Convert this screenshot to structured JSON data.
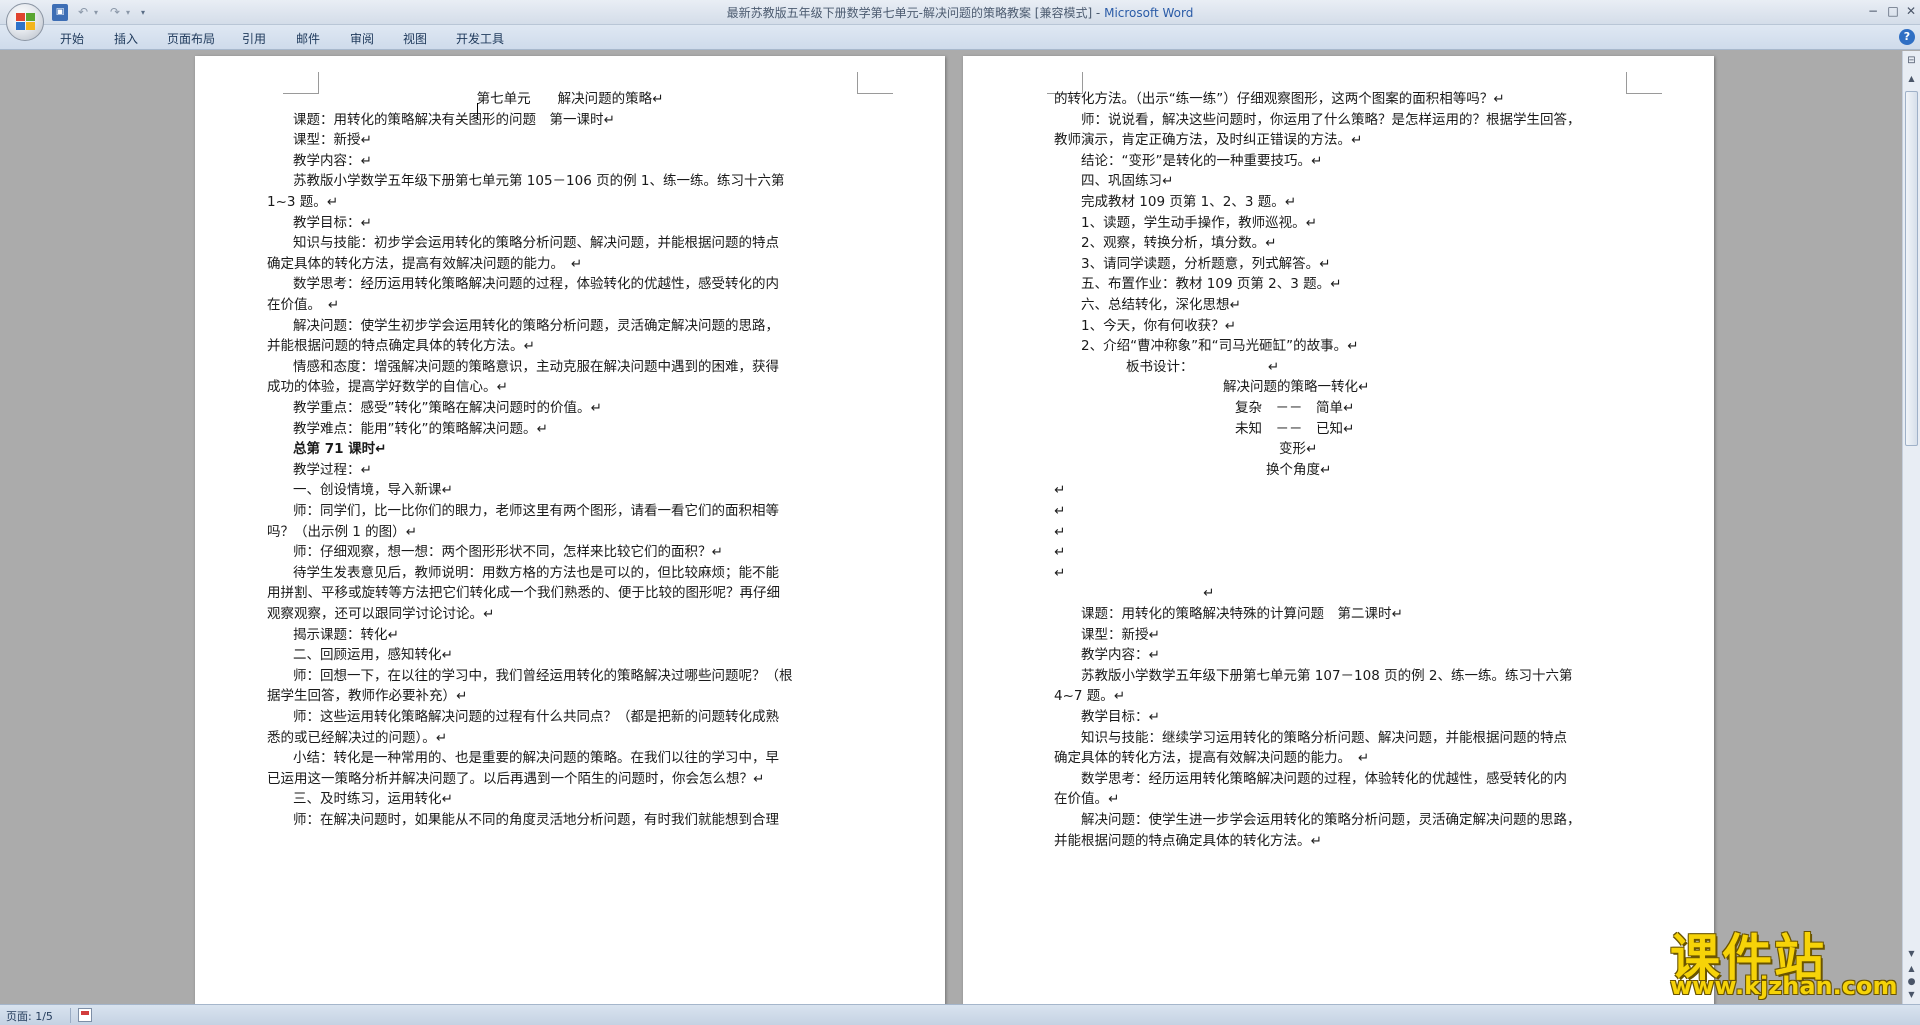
{
  "window": {
    "doc_title": "最新苏教版五年级下册数学第七单元-解决问题的策略教案 [兼容模式] - ",
    "app_name": "Microsoft Word",
    "minimize": "−",
    "maximize": "□",
    "close": "✕"
  },
  "quick_access": {
    "save_icon": "save-icon",
    "save_glyph": "▣",
    "undo_glyph": "↶",
    "redo_glyph": "↷",
    "drop_glyph": "▾",
    "customize_glyph": "▾"
  },
  "ribbon": {
    "tabs": [
      "开始",
      "插入",
      "页面布局",
      "引用",
      "邮件",
      "审阅",
      "视图",
      "开发工具"
    ],
    "help": "?"
  },
  "colors": {
    "logo_red": "#e0442f",
    "logo_green": "#5aa531",
    "logo_blue": "#2f73c9",
    "logo_yellow": "#f3b51c",
    "watermark": "#f6d308"
  },
  "left_page": {
    "lines": [
      "第七单元　　解决问题的策略↵",
      "课题：用转化的策略解决有关图形的问题　第一课时↵",
      "课型：新授↵",
      "教学内容：↵",
      "苏教版小学数学五年级下册第七单元第 105－106 页的例 1、练一练。练习十六第",
      "1~3 题。↵",
      "教学目标：↵",
      "知识与技能：初步学会运用转化的策略分析问题、解决问题，并能根据问题的特点",
      "确定具体的转化方法，提高有效解决问题的能力。　↵",
      "数学思考：经历运用转化策略解决问题的过程，体验转化的优越性，感受转化的内",
      "在价值。　↵",
      "解决问题：使学生初步学会运用转化的策略分析问题，灵活确定解决问题的思路，",
      "并能根据问题的特点确定具体的转化方法。↵",
      "情感和态度：增强解决问题的策略意识，主动克服在解决问题中遇到的困难，获得",
      "成功的体验，提高学好数学的自信心。↵",
      "教学重点：感受”转化”策略在解决问题时的价值。↵",
      "教学难点：能用”转化”的策略解决问题。↵",
      "总第 71 课时↵",
      "教学过程：↵",
      "一、创设情境，导入新课↵",
      "师：同学们，比一比你们的眼力，老师这里有两个图形，请看一看它们的面积相等",
      "吗？（出示例 1 的图）↵",
      "师：仔细观察，想一想：两个图形形状不同，怎样来比较它们的面积？↵",
      "待学生发表意见后，教师说明：用数方格的方法也是可以的，但比较麻烦；能不能",
      "用拼割、平移或旋转等方法把它们转化成一个我们熟悉的、便于比较的图形呢？再仔细",
      "观察观察，还可以跟同学讨论讨论。↵",
      "揭示课题：转化↵",
      "二、回顾运用，感知转化↵",
      "师：回想一下，在以往的学习中，我们曾经运用转化的策略解决过哪些问题呢？（根",
      "据学生回答，教师作必要补充）↵",
      "师：这些运用转化策略解决问题的过程有什么共同点？（都是把新的问题转化成熟",
      "悉的或已经解决过的问题）。↵",
      "小结：转化是一种常用的、也是重要的解决问题的策略。在我们以往的学习中，早",
      "已运用这一策略分析并解决问题了。以后再遇到一个陌生的问题时，你会怎么想？↵",
      "三、及时练习，运用转化↵",
      "师：在解决问题时，如果能从不同的角度灵活地分析问题，有时我们就能想到合理"
    ]
  },
  "right_page": {
    "lines": [
      "的转化方法。（出示“练一练”）仔细观察图形，这两个图案的面积相等吗？↵",
      "师：说说看，解决这些问题时，你运用了什么策略？是怎样运用的？根据学生回答，",
      "教师演示，肯定正确方法，及时纠正错误的方法。↵",
      "结论：“变形”是转化的一种重要技巧。↵",
      "四、巩固练习↵",
      "完成教材 109 页第 1、2、3 题。↵",
      "1、读题，学生动手操作，教师巡视。↵",
      "2、观察，转换分析，填分数。↵",
      "3、请同学读题，分析题意，列式解答。↵",
      "五、布置作业：教材 109 页第 2、3 题。↵",
      "六、总结转化，深化思想↵",
      "1、今天，你有何收获？↵",
      "2、介绍“曹冲称象”和“司马光砸缸”的故事。↵",
      "板书设计：　　　　　　↵",
      "解决问题的策略一转化↵",
      "复杂　－－　简单↵",
      "未知　－－　已知↵",
      "变形↵",
      "换个角度↵",
      "↵",
      "↵",
      "↵",
      "↵",
      "↵",
      "↵",
      "课题：用转化的策略解决特殊的计算问题　第二课时↵",
      "课型：新授↵",
      "教学内容：↵",
      "苏教版小学数学五年级下册第七单元第 107－108 页的例 2、练一练。练习十六第",
      "4~7 题。↵",
      "教学目标：↵",
      "知识与技能：继续学习运用转化的策略分析问题、解决问题，并能根据问题的特点",
      "确定具体的转化方法，提高有效解决问题的能力。　↵",
      "数学思考：经历运用转化策略解决问题的过程，体验转化的优越性，感受转化的内",
      "在价值。↵",
      "解决问题：使学生进一步学会运用转化的策略分析问题，灵活确定解决问题的思路，",
      "并能根据问题的特点确定具体的转化方法。↵"
    ]
  },
  "scrollbar": {
    "ruler_glyph": "⊟",
    "up": "▲",
    "down": "▼",
    "prev_page": "▲",
    "browse": "●",
    "next_page": "▼"
  },
  "status": {
    "page": "页面: 1/5",
    "lang_icon": "language-icon"
  },
  "watermark": {
    "main": "课件站",
    "url": "www.kjzhan.com"
  }
}
